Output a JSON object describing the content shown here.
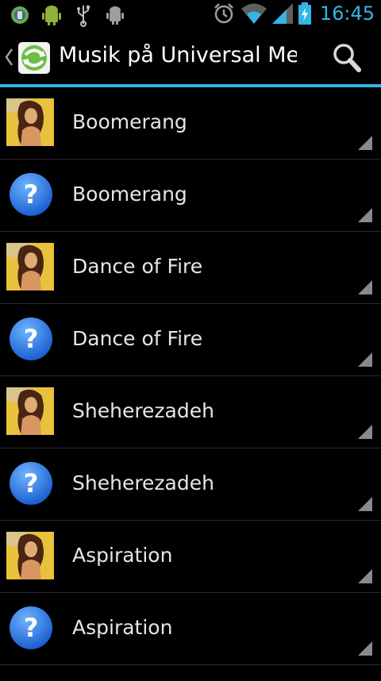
{
  "status_bar": {
    "time": "16:45",
    "left_icons": [
      "app-notification-icon",
      "android-icon",
      "usb-icon",
      "usb-debugging-icon"
    ],
    "right_icons": [
      "alarm-icon",
      "wifi-icon",
      "signal-icon",
      "battery-charging-icon"
    ],
    "accent_color": "#33b5e5"
  },
  "action_bar": {
    "title": "Musik på Universal Me…",
    "up_icon": "chevron-left-icon",
    "app_icon": "universal-media-icon",
    "action_icon": "search-icon"
  },
  "list": {
    "items": [
      {
        "title": "Boomerang",
        "icon": "album-art"
      },
      {
        "title": "Boomerang",
        "icon": "help-icon"
      },
      {
        "title": "Dance of Fire",
        "icon": "album-art"
      },
      {
        "title": "Dance of Fire",
        "icon": "help-icon"
      },
      {
        "title": "Sheherezadeh",
        "icon": "album-art"
      },
      {
        "title": "Sheherezadeh",
        "icon": "help-icon"
      },
      {
        "title": "Aspiration",
        "icon": "album-art"
      },
      {
        "title": "Aspiration",
        "icon": "help-icon"
      }
    ]
  }
}
